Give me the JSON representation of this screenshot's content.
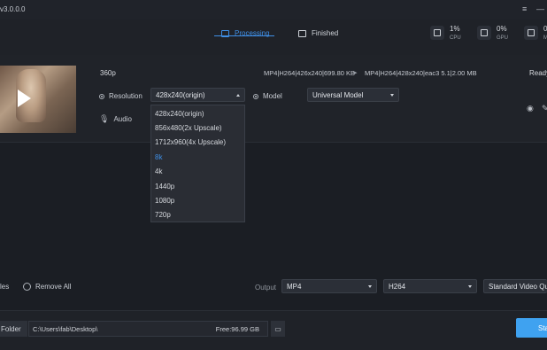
{
  "app": {
    "version": "v3.0.0.0"
  },
  "window_controls": {
    "menu_icon": "≡",
    "minimize_icon": "—"
  },
  "tabs": [
    {
      "label": "Processing",
      "active": true
    },
    {
      "label": "Finished",
      "active": false
    }
  ],
  "stats": [
    {
      "value": "1%",
      "label": "CPU"
    },
    {
      "value": "0%",
      "label": "GPU"
    },
    {
      "value": "0.",
      "label": "ME"
    }
  ],
  "task": {
    "name": "360p",
    "input_info": "MP4|H264|426x240|699.80 KB",
    "output_info": "MP4|H264|428x240|eac3 5.1|2.00 MB",
    "status": "Ready",
    "resolution_label": "Resolution",
    "resolution_value": "428x240(origin)",
    "model_label": "Model",
    "model_value": "Universal Model",
    "audio_label": "Audio"
  },
  "resolution_options": [
    "428x240(origin)",
    "856x480(2x Upscale)",
    "1712x960(4x Upscale)",
    "8k",
    "4k",
    "1440p",
    "1080p",
    "720p"
  ],
  "highlighted_option_index": 3,
  "bottom": {
    "files_label": "les",
    "remove_all": "Remove All",
    "output_label": "Output",
    "format": "MP4",
    "codec": "H264",
    "quality": "Standard Video Qua"
  },
  "footer": {
    "folder_label": "Folder",
    "path": "C:\\Users\\fab\\Desktop\\",
    "free": "Free:96.99 GB",
    "start": "Sta"
  },
  "colors": {
    "accent": "#3f8fe6",
    "start_button": "#3fa2f0",
    "background": "#1b1e24"
  }
}
